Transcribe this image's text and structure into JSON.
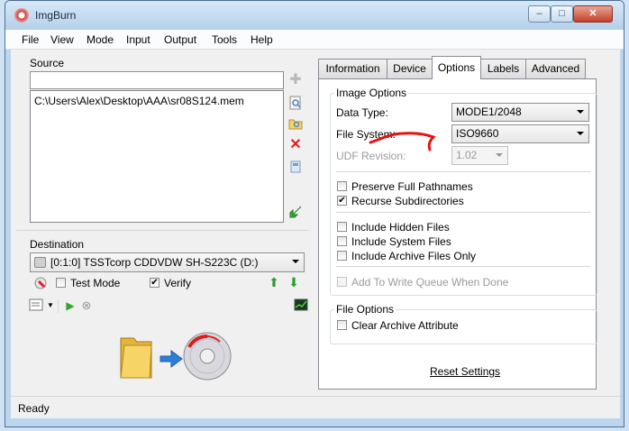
{
  "window": {
    "title": "ImgBurn",
    "min_glyph": "–",
    "max_glyph": "□",
    "close_glyph": "✕"
  },
  "menu": [
    "File",
    "View",
    "Mode",
    "Input",
    "Output",
    "Tools",
    "Help"
  ],
  "source": {
    "label": "Source",
    "combo_value": "",
    "path": "C:\\Users\\Alex\\Desktop\\AAA\\sr08S124.mem"
  },
  "destination": {
    "label": "Destination",
    "drive": "[0:1:0] TSSTcorp CDDVDW SH-S223C (D:)",
    "test_mode_label": "Test Mode",
    "verify_label": "Verify",
    "test_mode_checked": false,
    "verify_checked": true
  },
  "tabs": [
    {
      "label": "Information",
      "active": false
    },
    {
      "label": "Device",
      "active": false
    },
    {
      "label": "Options",
      "active": true
    },
    {
      "label": "Labels",
      "active": false
    },
    {
      "label": "Advanced",
      "active": false
    }
  ],
  "image_options": {
    "title": "Image Options",
    "data_type_label": "Data Type:",
    "data_type_value": "MODE1/2048",
    "file_system_label": "File System:",
    "file_system_value": "ISO9660",
    "udf_revision_label": "UDF Revision:",
    "udf_revision_value": "1.02",
    "checkboxes": [
      {
        "label": "Preserve Full Pathnames",
        "checked": false,
        "enabled": true
      },
      {
        "label": "Recurse Subdirectories",
        "checked": true,
        "enabled": true
      },
      {
        "label": "Include Hidden Files",
        "checked": false,
        "enabled": true
      },
      {
        "label": "Include System Files",
        "checked": false,
        "enabled": true
      },
      {
        "label": "Include Archive Files Only",
        "checked": false,
        "enabled": true
      },
      {
        "label": "Add To Write Queue When Done",
        "checked": false,
        "enabled": false
      }
    ]
  },
  "file_options": {
    "title": "File Options",
    "clear_archive_label": "Clear Archive Attribute",
    "clear_archive_checked": false
  },
  "reset_label": "Reset Settings",
  "status": "Ready",
  "colors": {
    "accent": "#3a7bd5",
    "annotation": "#e81010",
    "window_frame": "#bcd6ee"
  }
}
